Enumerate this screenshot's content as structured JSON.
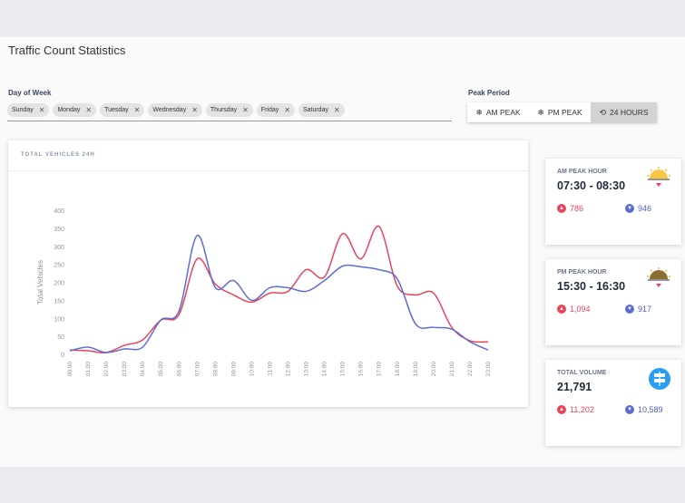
{
  "page": {
    "title": "Traffic Count Statistics"
  },
  "filters": {
    "day_label": "Day of Week",
    "days": [
      "Sunday",
      "Monday",
      "Tuesday",
      "Wednesday",
      "Thursday",
      "Friday",
      "Saturday"
    ],
    "peak_label": "Peak Period",
    "peak_options": [
      "AM PEAK",
      "PM PEAK",
      "24 HOURS"
    ],
    "peak_selected": "24 HOURS"
  },
  "chart_card": {
    "title": "TOTAL VEHICLES 24H"
  },
  "chart_data": {
    "type": "line",
    "title": "TOTAL VEHICLES 24H",
    "xlabel": "",
    "ylabel": "Total Vehicles",
    "ylim": [
      0,
      400
    ],
    "yticks": [
      0,
      50,
      100,
      150,
      200,
      250,
      300,
      350,
      400
    ],
    "grid": false,
    "legend": "none",
    "x": [
      "00:00",
      "01:00",
      "02:00",
      "03:00",
      "04:00",
      "05:00",
      "06:00",
      "07:00",
      "08:00",
      "09:00",
      "10:00",
      "11:00",
      "12:00",
      "13:00",
      "14:00",
      "15:00",
      "16:00",
      "17:00",
      "18:00",
      "19:00",
      "20:00",
      "21:00",
      "22:00",
      "23:00"
    ],
    "series": [
      {
        "color": "#e8455b",
        "values": [
          12,
          10,
          5,
          25,
          40,
          95,
          110,
          265,
          195,
          165,
          145,
          170,
          175,
          235,
          215,
          335,
          265,
          355,
          190,
          165,
          170,
          75,
          38,
          35
        ]
      },
      {
        "color": "#5b6dd6",
        "values": [
          10,
          20,
          5,
          15,
          20,
          95,
          120,
          330,
          185,
          205,
          150,
          185,
          185,
          175,
          205,
          245,
          243,
          235,
          210,
          85,
          75,
          70,
          35,
          12
        ]
      }
    ]
  },
  "stats": [
    {
      "label": "AM PEAK HOUR",
      "value": "07:30 - 08:30",
      "up": "786",
      "down": "946",
      "icon": "sunrise-icon"
    },
    {
      "label": "PM PEAK HOUR",
      "value": "15:30 - 16:30",
      "up": "1,094",
      "down": "917",
      "icon": "sunset-icon"
    },
    {
      "label": "TOTAL VOLUME",
      "value": "21,791",
      "up": "11,202",
      "down": "10,589",
      "icon": "road-sign-icon"
    }
  ],
  "colors": {
    "accent_red": "#e8455b",
    "accent_blue": "#5b6dd6",
    "sun": "#f7c744",
    "sign": "#2a9df4"
  }
}
